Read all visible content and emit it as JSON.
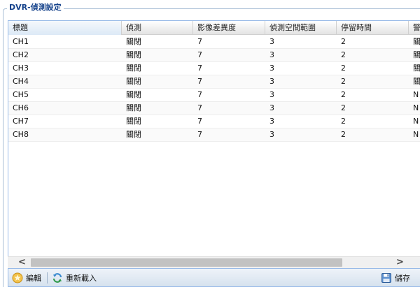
{
  "panel": {
    "title": "DVR-偵測設定"
  },
  "grid": {
    "columns": [
      "標題",
      "偵測",
      "影像差異度",
      "偵測空間範圍",
      "停留時間",
      "警"
    ],
    "rows": [
      [
        "CH1",
        "關閉",
        "7",
        "3",
        "2",
        "關"
      ],
      [
        "CH2",
        "關閉",
        "7",
        "3",
        "2",
        "關"
      ],
      [
        "CH3",
        "關閉",
        "7",
        "3",
        "2",
        "關"
      ],
      [
        "CH4",
        "關閉",
        "7",
        "3",
        "2",
        "關"
      ],
      [
        "CH5",
        "關閉",
        "7",
        "3",
        "2",
        "N"
      ],
      [
        "CH6",
        "關閉",
        "7",
        "3",
        "2",
        "N"
      ],
      [
        "CH7",
        "關閉",
        "7",
        "3",
        "2",
        "N"
      ],
      [
        "CH8",
        "關閉",
        "7",
        "3",
        "2",
        "N"
      ]
    ]
  },
  "scrollbar": {
    "left_arrow": "<",
    "right_arrow": ">"
  },
  "toolbar": {
    "edit_label": "編輯",
    "reload_label": "重新載入",
    "save_label": "儲存"
  },
  "icons": {
    "edit": "edit-star-icon",
    "reload": "reload-icon",
    "save": "floppy-disk-icon"
  },
  "colors": {
    "accent": "#15428b",
    "border": "#99bbe8"
  }
}
